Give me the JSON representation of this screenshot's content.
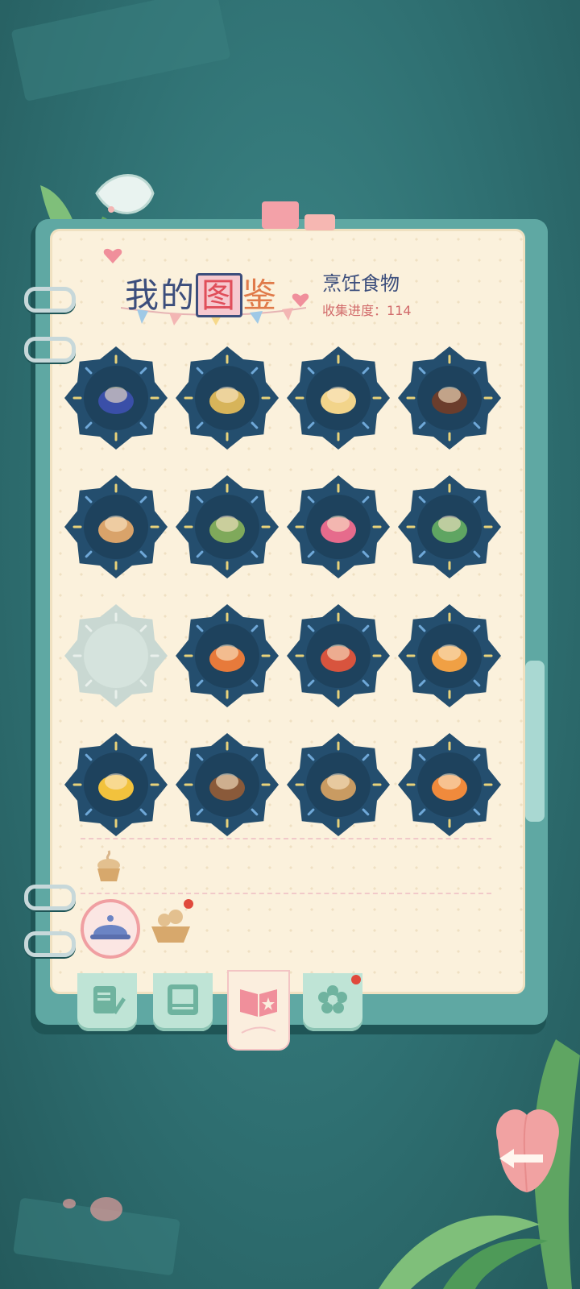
{
  "header": {
    "title_part1": "我的",
    "title_highlight": "图",
    "title_part2": "鉴",
    "category": "烹饪食物",
    "progress_label": "收集进度：",
    "progress_value": "114"
  },
  "collection": {
    "items": [
      {
        "name": "dessert-swirl",
        "collected": true,
        "color": "#3a4fa8"
      },
      {
        "name": "cheese-wedge",
        "collected": true,
        "color": "#d7b45a"
      },
      {
        "name": "music-toast",
        "collected": true,
        "color": "#f2d48a"
      },
      {
        "name": "bear-donut",
        "collected": true,
        "color": "#6b3d2c"
      },
      {
        "name": "ship-cake",
        "collected": true,
        "color": "#d9a36a"
      },
      {
        "name": "forest-pie",
        "collected": true,
        "color": "#7fa95b"
      },
      {
        "name": "strawberry-cake",
        "collected": true,
        "color": "#e66b8c"
      },
      {
        "name": "herb-skewer",
        "collected": true,
        "color": "#5fa562"
      },
      {
        "name": "empty-slot",
        "collected": false,
        "color": "#cfe0d8"
      },
      {
        "name": "orange-cookies",
        "collected": true,
        "color": "#e77a3b"
      },
      {
        "name": "red-biscuits",
        "collected": true,
        "color": "#d8543e"
      },
      {
        "name": "pumpkin",
        "collected": true,
        "color": "#f0a044"
      },
      {
        "name": "cheese-chips",
        "collected": true,
        "color": "#f2c23d"
      },
      {
        "name": "meat-skewer",
        "collected": true,
        "color": "#8a5a3a"
      },
      {
        "name": "soup-bowl",
        "collected": true,
        "color": "#c99b62"
      },
      {
        "name": "jam-jar",
        "collected": true,
        "color": "#f08a3c"
      }
    ]
  },
  "subtabs": [
    {
      "name": "cupcake",
      "active": false
    },
    {
      "name": "cloche",
      "active": true
    },
    {
      "name": "basket",
      "active": false,
      "notification": true
    }
  ],
  "tabs": [
    {
      "name": "notes",
      "active": false
    },
    {
      "name": "photos",
      "active": false
    },
    {
      "name": "encyclopedia",
      "active": true
    },
    {
      "name": "flower",
      "active": false,
      "notification": true
    }
  ],
  "colors": {
    "badge": "#244e6e",
    "badge_empty": "#c9d8d2",
    "accent": "#e04e5a",
    "paper": "#fbf1dc"
  }
}
